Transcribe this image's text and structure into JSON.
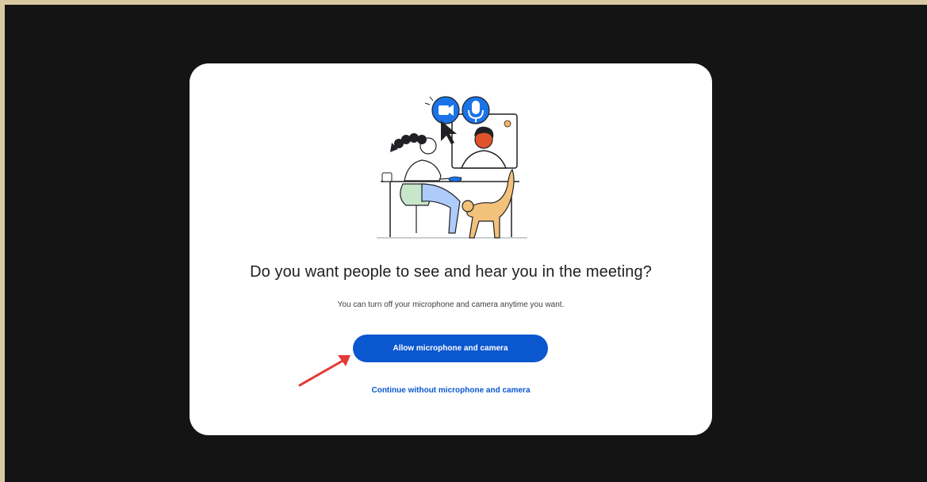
{
  "dialog": {
    "title": "Do you want people to see and hear you in the meeting?",
    "subtitle": "You can turn off your microphone and camera anytime you want.",
    "primary_label": "Allow microphone and camera",
    "secondary_label": "Continue without microphone and camera"
  },
  "icons": {
    "illustration": "video-call-illustration",
    "camera": "camera-icon",
    "microphone": "microphone-icon",
    "cursor": "cursor-icon",
    "annotation_arrow": "red-arrow-annotation"
  },
  "colors": {
    "background": "#141414",
    "frame_border": "#d9c9a3",
    "dialog_bg": "#ffffff",
    "accent": "#0b57d0",
    "annotation": "#e53935"
  }
}
